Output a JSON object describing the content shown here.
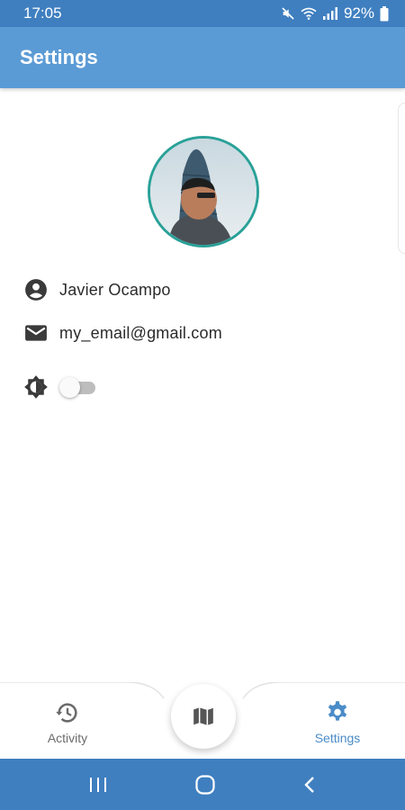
{
  "status_bar": {
    "time": "17:05",
    "battery": "92%"
  },
  "app_bar": {
    "title": "Settings"
  },
  "profile": {
    "name": "Javier Ocampo",
    "email": "my_email@gmail.com",
    "dark_mode_enabled": false,
    "icons": {
      "name": "account-circle-icon",
      "email": "mail-icon",
      "theme": "brightness-icon"
    }
  },
  "bottom_nav": {
    "items": [
      {
        "label": "Activity",
        "icon": "history-icon",
        "active": false
      },
      {
        "label": "",
        "icon": "map-icon",
        "active": false
      },
      {
        "label": "Settings",
        "icon": "gear-icon",
        "active": true
      }
    ]
  },
  "colors": {
    "app_bar": "#5b9bd5",
    "status_bar": "#3f7fc0",
    "accent": "#4a8cc8",
    "avatar_border": "#2aa198"
  }
}
